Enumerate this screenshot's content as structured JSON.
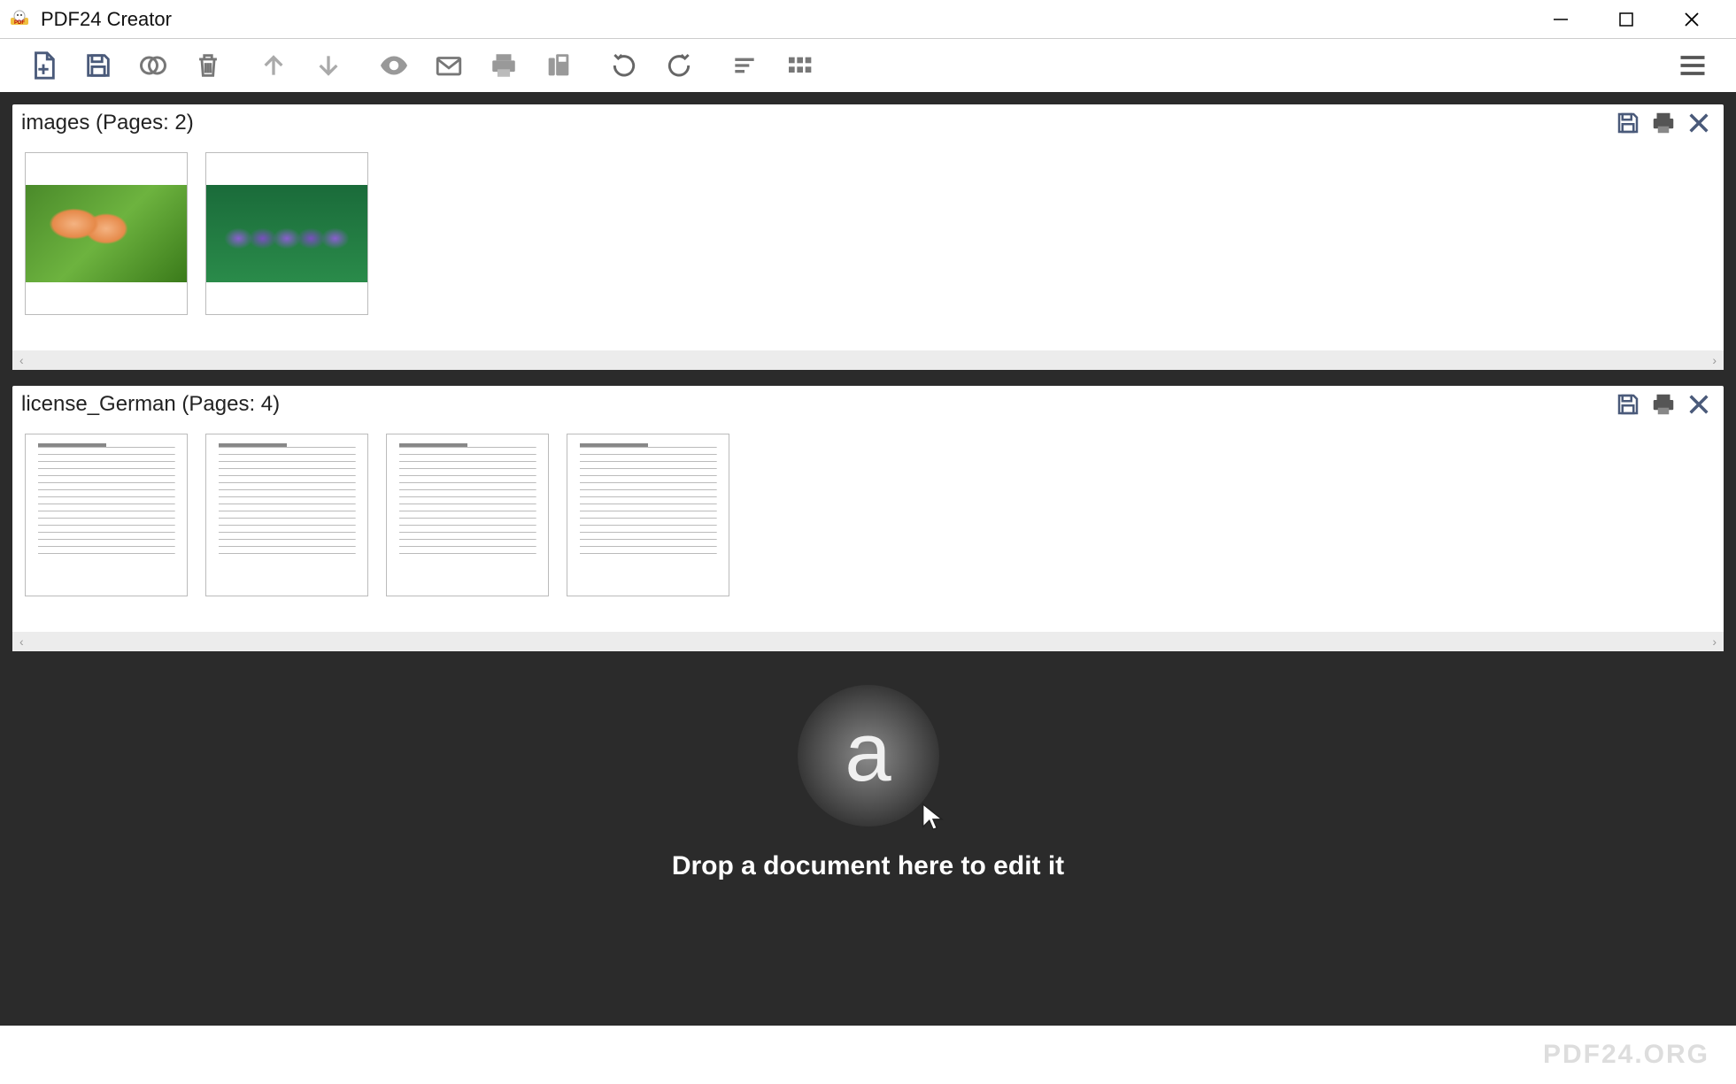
{
  "window": {
    "title": "PDF24 Creator"
  },
  "documents": [
    {
      "name": "images",
      "pages": 2,
      "title": "images (Pages: 2)"
    },
    {
      "name": "license_German",
      "pages": 4,
      "title": "license_German (Pages: 4)"
    }
  ],
  "dropzone": {
    "label": "Drop a document here to edit it"
  },
  "footer": {
    "brand": "PDF24.ORG"
  }
}
